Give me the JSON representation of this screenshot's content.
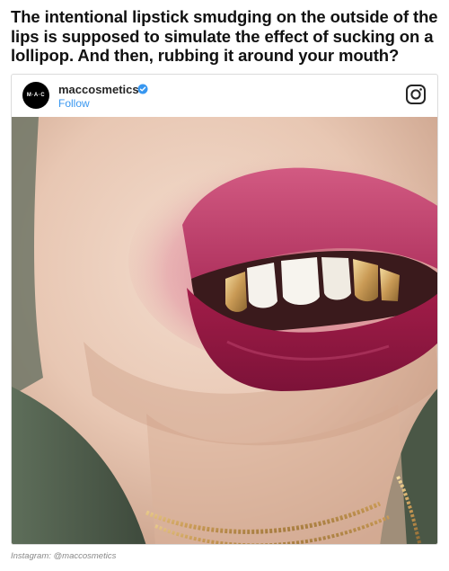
{
  "headline": "The intentional lipstick smudging on the outside of the lips is supposed to simulate the effect of sucking on a lollipop. And then, rubbing it around your mouth?",
  "post": {
    "avatar_text": "M·A·C",
    "username": "maccosmetics",
    "follow_label": "Follow",
    "verified_icon": "verified-check-icon",
    "platform_icon": "instagram-icon",
    "accent_color": "#3897f0",
    "photo_subject": "close-up of smudged pink lips with gold grills and gold chain necklace"
  },
  "credit": "Instagram: @maccosmetics"
}
